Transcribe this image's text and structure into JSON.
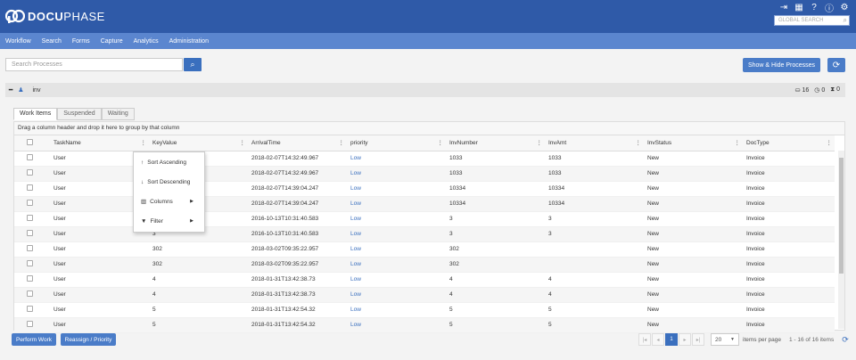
{
  "brand": {
    "name_bold": "DOCU",
    "name_rest": "PHASE"
  },
  "header": {
    "global_search_placeholder": "GLOBAL SEARCH"
  },
  "nav": [
    "Workflow",
    "Search",
    "Forms",
    "Capture",
    "Analytics",
    "Administration"
  ],
  "toolbar": {
    "search_placeholder": "Search Processes",
    "show_hide_label": "Show & Hide Processes"
  },
  "group": {
    "name": "inv",
    "count_inbox": "16",
    "count_clock": "0",
    "count_hourglass": "0"
  },
  "tabs": [
    "Work Items",
    "Suspended",
    "Waiting"
  ],
  "grid": {
    "drag_hint": "Drag a column header and drop it here to group by that column",
    "columns": [
      "TaskName",
      "KeyValue",
      "ArrivalTime",
      "priority",
      "InvNumber",
      "InvAmt",
      "InvStatus",
      "DocType"
    ],
    "rows": [
      [
        "User",
        "",
        "2018-02-07T14:32:49.967",
        "Low",
        "1033",
        "1033",
        "New",
        "Invoice"
      ],
      [
        "User",
        "",
        "2018-02-07T14:32:49.967",
        "Low",
        "1033",
        "1033",
        "New",
        "Invoice"
      ],
      [
        "User",
        "",
        "2018-02-07T14:39:04.247",
        "Low",
        "10334",
        "10334",
        "New",
        "Invoice"
      ],
      [
        "User",
        "",
        "2018-02-07T14:39:04.247",
        "Low",
        "10334",
        "10334",
        "New",
        "Invoice"
      ],
      [
        "User",
        "",
        "2016-10-13T10:31:40.583",
        "Low",
        "3",
        "3",
        "New",
        "Invoice"
      ],
      [
        "User",
        "3",
        "2016-10-13T10:31:40.583",
        "Low",
        "3",
        "3",
        "New",
        "Invoice"
      ],
      [
        "User",
        "302",
        "2018-03-02T09:35:22.957",
        "Low",
        "302",
        "",
        "New",
        "Invoice"
      ],
      [
        "User",
        "302",
        "2018-03-02T09:35:22.957",
        "Low",
        "302",
        "",
        "New",
        "Invoice"
      ],
      [
        "User",
        "4",
        "2018-01-31T13:42:38.73",
        "Low",
        "4",
        "4",
        "New",
        "Invoice"
      ],
      [
        "User",
        "4",
        "2018-01-31T13:42:38.73",
        "Low",
        "4",
        "4",
        "New",
        "Invoice"
      ],
      [
        "User",
        "5",
        "2018-01-31T13:42:54.32",
        "Low",
        "5",
        "5",
        "New",
        "Invoice"
      ],
      [
        "User",
        "5",
        "2018-01-31T13:42:54.32",
        "Low",
        "5",
        "5",
        "New",
        "Invoice"
      ]
    ]
  },
  "context_menu": {
    "sort_asc": "Sort Ascending",
    "sort_desc": "Sort Descending",
    "columns": "Columns",
    "filter": "Filter"
  },
  "footer": {
    "perform_work": "Perform Work",
    "reassign": "Reassign / Priority"
  },
  "pager": {
    "current_page": "1",
    "page_size": "20",
    "items_per_page": "items per page",
    "info": "1 - 16 of 16 items"
  }
}
